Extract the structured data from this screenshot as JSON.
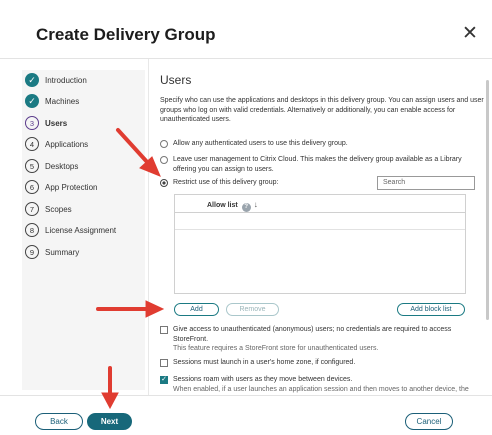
{
  "dialog": {
    "title": "Create Delivery Group"
  },
  "icons": {
    "close": "close-icon",
    "check": "check-icon",
    "info": "info-icon",
    "sort": "sort-down-arrow-icon"
  },
  "steps": [
    {
      "num": "",
      "label": "Introduction",
      "state": "done"
    },
    {
      "num": "",
      "label": "Machines",
      "state": "done"
    },
    {
      "num": "3",
      "label": "Users",
      "state": "current"
    },
    {
      "num": "4",
      "label": "Applications",
      "state": "todo"
    },
    {
      "num": "5",
      "label": "Desktops",
      "state": "todo"
    },
    {
      "num": "6",
      "label": "App Protection",
      "state": "todo"
    },
    {
      "num": "7",
      "label": "Scopes",
      "state": "todo"
    },
    {
      "num": "8",
      "label": "License Assignment",
      "state": "todo"
    },
    {
      "num": "9",
      "label": "Summary",
      "state": "todo"
    }
  ],
  "users": {
    "heading": "Users",
    "description": "Specify who can use the applications and desktops in this delivery group. You can assign users and user groups who log on with valid credentials. Alternatively or additionally, you can enable access for unauthenticated users.",
    "radio_any": "Allow any authenticated users to use this delivery group.",
    "radio_cloud": "Leave user management to Citrix Cloud. This makes the delivery group available as a Library offering you can assign to users.",
    "radio_restrict": "Restrict use of this delivery group:",
    "selected_radio": "restrict",
    "search_placeholder": "Search",
    "allow_list_header": "Allow list",
    "add_label": "Add",
    "remove_label": "Remove",
    "add_block_label": "Add block list",
    "unauth_label": "Give access to unauthenticated (anonymous) users; no credentials are required to access StoreFront.",
    "unauth_sub": "This feature requires a StoreFront store for unauthenticated users.",
    "unauth_checked": false,
    "homezone_label": "Sessions must launch in a user's home zone, if configured.",
    "homezone_checked": false,
    "roam_label": "Sessions roam with users as they move between devices.",
    "roam_sub": "When enabled, if a user launches an application session and then moves to another device, the same session is used and available on both devices. When disabled, the session no longer roams between devices.",
    "roam_checked": true
  },
  "footer": {
    "back_label": "Back",
    "next_label": "Next",
    "cancel_label": "Cancel"
  },
  "colors": {
    "accent": "#1b7a83",
    "primary_button": "#17687a",
    "annotation_arrow": "#e03c31",
    "current_step": "#5c3c8c"
  }
}
